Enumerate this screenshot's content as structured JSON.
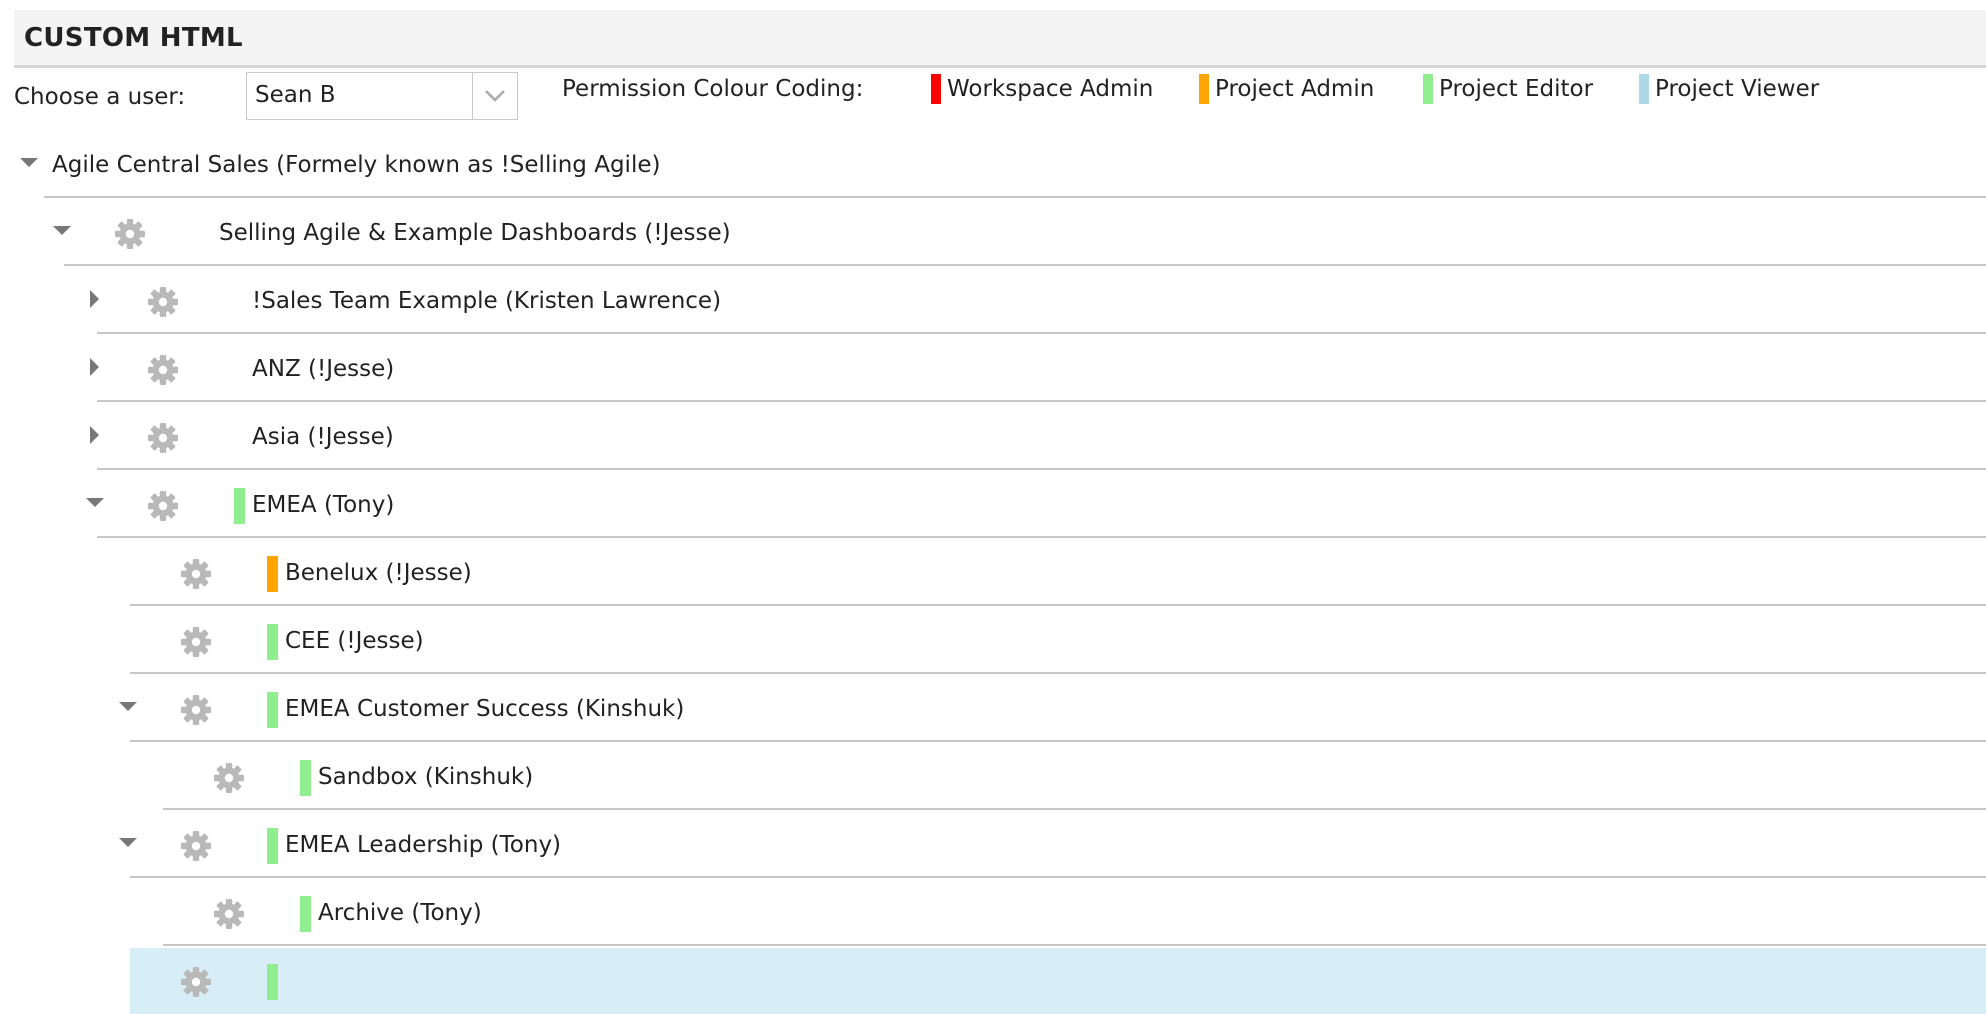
{
  "panel": {
    "title": "CUSTOM HTML"
  },
  "user_picker": {
    "label": "Choose a user:",
    "selected": "Sean B"
  },
  "legend": {
    "label": "Permission Colour Coding:",
    "items": [
      {
        "name": "Workspace Admin",
        "color": "#ff0000"
      },
      {
        "name": "Project Admin",
        "color": "#ffa500"
      },
      {
        "name": "Project Editor",
        "color": "#90ee90"
      },
      {
        "name": "Project Viewer",
        "color": "#add8e6"
      }
    ]
  },
  "tree": {
    "rows": [
      {
        "label": "Agile Central Sales (Formely known as !Selling Agile)",
        "expanded": true,
        "has_children": true,
        "gear": false,
        "permission": null
      },
      {
        "label": "Selling Agile & Example Dashboards (!Jesse)",
        "expanded": true,
        "has_children": true,
        "gear": true,
        "permission": null
      },
      {
        "label": "!Sales Team Example (Kristen Lawrence)",
        "expanded": false,
        "has_children": true,
        "gear": true,
        "permission": null
      },
      {
        "label": "ANZ (!Jesse)",
        "expanded": false,
        "has_children": true,
        "gear": true,
        "permission": null
      },
      {
        "label": "Asia (!Jesse)",
        "expanded": false,
        "has_children": true,
        "gear": true,
        "permission": null
      },
      {
        "label": "EMEA (Tony)",
        "expanded": true,
        "has_children": true,
        "gear": true,
        "permission": "Project Editor"
      },
      {
        "label": "Benelux (!Jesse)",
        "expanded": false,
        "has_children": false,
        "gear": true,
        "permission": "Project Admin"
      },
      {
        "label": "CEE (!Jesse)",
        "expanded": false,
        "has_children": false,
        "gear": true,
        "permission": "Project Editor"
      },
      {
        "label": "EMEA Customer Success (Kinshuk)",
        "expanded": true,
        "has_children": true,
        "gear": true,
        "permission": "Project Editor"
      },
      {
        "label": "Sandbox (Kinshuk)",
        "expanded": false,
        "has_children": false,
        "gear": true,
        "permission": "Project Editor"
      },
      {
        "label": "EMEA Leadership (Tony)",
        "expanded": true,
        "has_children": true,
        "gear": true,
        "permission": "Project Editor"
      },
      {
        "label": "Archive (Tony)",
        "expanded": false,
        "has_children": false,
        "gear": true,
        "permission": "Project Editor"
      },
      {
        "label": "",
        "expanded": false,
        "has_children": false,
        "gear": true,
        "permission": "Project Editor",
        "selected": true
      }
    ]
  }
}
